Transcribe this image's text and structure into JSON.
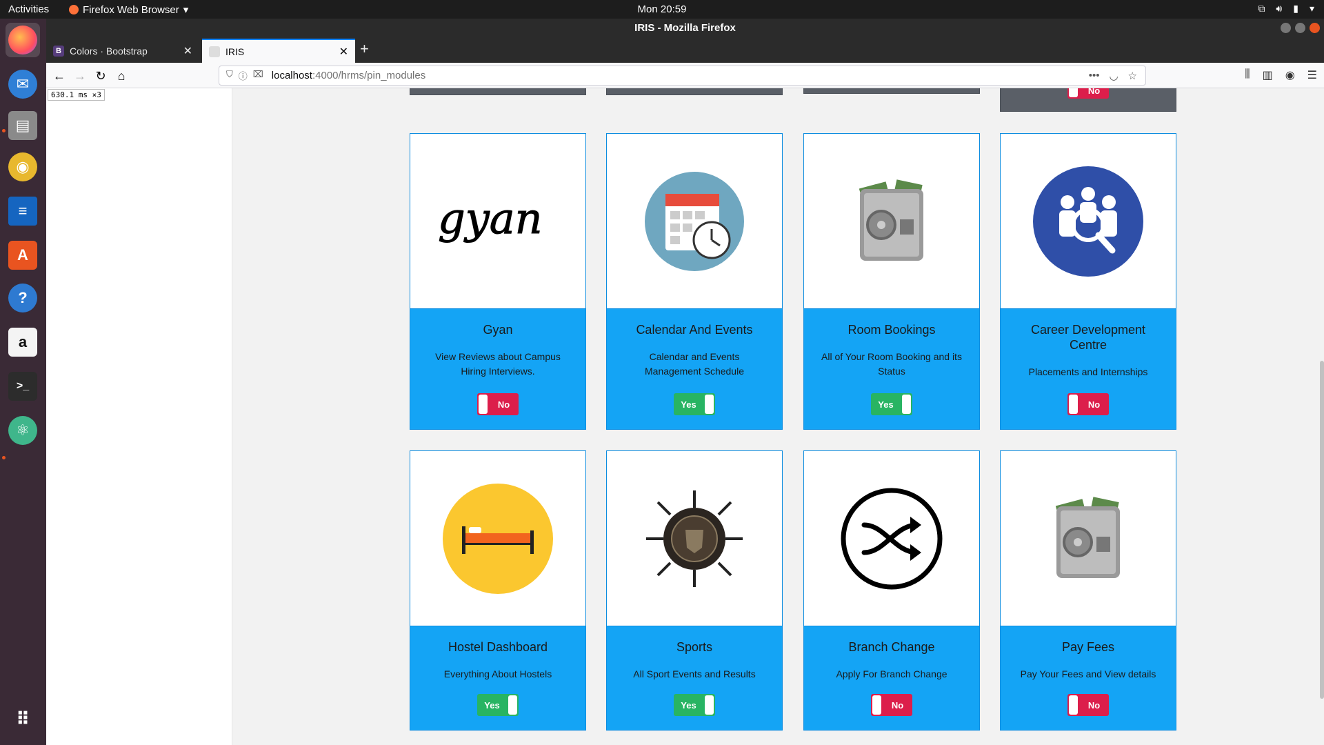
{
  "topbar": {
    "activities": "Activities",
    "app_menu": "Firefox Web Browser",
    "clock": "Mon 20:59"
  },
  "window": {
    "title": "IRIS - Mozilla Firefox"
  },
  "tabs": [
    {
      "label": "Colors · Bootstrap",
      "favicon": "B"
    },
    {
      "label": "IRIS"
    }
  ],
  "url": {
    "host": "localhost",
    "path": ":4000/hrms/pin_modules"
  },
  "perf_counter": "630.1 ms ×3",
  "top_partial_toggle_label": "No",
  "cards": [
    {
      "title": "Gyan",
      "description": "View Reviews about Campus Hiring Interviews.",
      "toggle": "No",
      "state": "no",
      "image": "gyan-logo"
    },
    {
      "title": "Calendar And Events",
      "description": "Calendar and Events Management Schedule",
      "toggle": "Yes",
      "state": "yes",
      "image": "calendar-clock-icon"
    },
    {
      "title": "Room Bookings",
      "description": "All of Your Room Booking and its Status",
      "toggle": "Yes",
      "state": "yes",
      "image": "safe-icon"
    },
    {
      "title": "Career Development Centre",
      "description": "Placements and Internships",
      "toggle": "No",
      "state": "no",
      "image": "career-people-icon"
    },
    {
      "title": "Hostel Dashboard",
      "description": "Everything About Hostels",
      "toggle": "Yes",
      "state": "yes",
      "image": "bed-icon"
    },
    {
      "title": "Sports",
      "description": "All Sport Events and Results",
      "toggle": "Yes",
      "state": "yes",
      "image": "sports-emblem"
    },
    {
      "title": "Branch Change",
      "description": "Apply For Branch Change",
      "toggle": "No",
      "state": "no",
      "image": "shuffle-icon"
    },
    {
      "title": "Pay Fees",
      "description": "Pay Your Fees and View details",
      "toggle": "No",
      "state": "no",
      "image": "safe-icon"
    }
  ]
}
